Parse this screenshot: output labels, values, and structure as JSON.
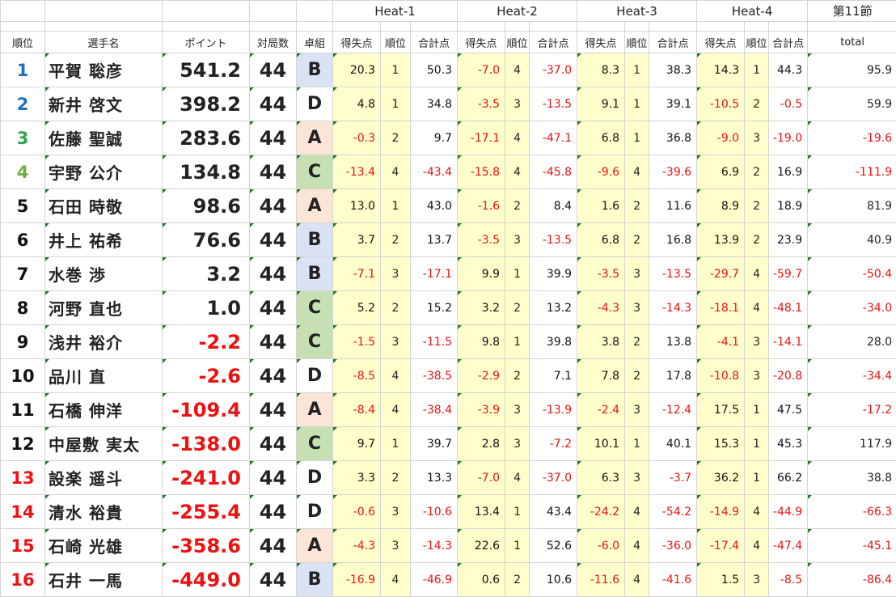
{
  "colors": {
    "group_B": "#dae3f3",
    "group_A": "#fbe5d6",
    "group_C": "#c6e0b4",
    "group_D": "#ffffff",
    "rank_1": "#1f6fc5",
    "rank_2": "#1f6fc5",
    "rank_3": "#2ea84a",
    "rank_4": "#70ad47",
    "rank_default": "#111111",
    "rank_bottom": "#ee1111",
    "negative": "#ee1111",
    "score_bg": "#ffffcc"
  },
  "header": {
    "heats": [
      "Heat-1",
      "Heat-2",
      "Heat-3",
      "Heat-4"
    ],
    "section": "第11節",
    "rank": "順位",
    "player": "選手名",
    "points": "ポイント",
    "games": "対局数",
    "table": "卓組",
    "score": "得失点",
    "place": "順位",
    "subtotal": "合計点",
    "total": "total"
  },
  "rows": [
    {
      "rank": "1",
      "name": "平賀 聡彦",
      "points": "541.2",
      "games": "44",
      "group": "B",
      "heats": [
        [
          "20.3",
          "1",
          "50.3"
        ],
        [
          "-7.0",
          "4",
          "-37.0"
        ],
        [
          "8.3",
          "1",
          "38.3"
        ],
        [
          "14.3",
          "1",
          "44.3"
        ]
      ],
      "total": "95.9"
    },
    {
      "rank": "2",
      "name": "新井 啓文",
      "points": "398.2",
      "games": "44",
      "group": "D",
      "heats": [
        [
          "4.8",
          "1",
          "34.8"
        ],
        [
          "-3.5",
          "3",
          "-13.5"
        ],
        [
          "9.1",
          "1",
          "39.1"
        ],
        [
          "-10.5",
          "2",
          "-0.5"
        ]
      ],
      "total": "59.9"
    },
    {
      "rank": "3",
      "name": "佐藤 聖誠",
      "points": "283.6",
      "games": "44",
      "group": "A",
      "heats": [
        [
          "-0.3",
          "2",
          "9.7"
        ],
        [
          "-17.1",
          "4",
          "-47.1"
        ],
        [
          "6.8",
          "1",
          "36.8"
        ],
        [
          "-9.0",
          "3",
          "-19.0"
        ]
      ],
      "total": "-19.6"
    },
    {
      "rank": "4",
      "name": "宇野 公介",
      "points": "134.8",
      "games": "44",
      "group": "C",
      "heats": [
        [
          "-13.4",
          "4",
          "-43.4"
        ],
        [
          "-15.8",
          "4",
          "-45.8"
        ],
        [
          "-9.6",
          "4",
          "-39.6"
        ],
        [
          "6.9",
          "2",
          "16.9"
        ]
      ],
      "total": "-111.9"
    },
    {
      "rank": "5",
      "name": "石田 時敬",
      "points": "98.6",
      "games": "44",
      "group": "A",
      "heats": [
        [
          "13.0",
          "1",
          "43.0"
        ],
        [
          "-1.6",
          "2",
          "8.4"
        ],
        [
          "1.6",
          "2",
          "11.6"
        ],
        [
          "8.9",
          "2",
          "18.9"
        ]
      ],
      "total": "81.9"
    },
    {
      "rank": "6",
      "name": "井上 祐希",
      "points": "76.6",
      "games": "44",
      "group": "B",
      "heats": [
        [
          "3.7",
          "2",
          "13.7"
        ],
        [
          "-3.5",
          "3",
          "-13.5"
        ],
        [
          "6.8",
          "2",
          "16.8"
        ],
        [
          "13.9",
          "2",
          "23.9"
        ]
      ],
      "total": "40.9"
    },
    {
      "rank": "7",
      "name": "水巻 渉",
      "points": "3.2",
      "games": "44",
      "group": "B",
      "heats": [
        [
          "-7.1",
          "3",
          "-17.1"
        ],
        [
          "9.9",
          "1",
          "39.9"
        ],
        [
          "-3.5",
          "3",
          "-13.5"
        ],
        [
          "-29.7",
          "4",
          "-59.7"
        ]
      ],
      "total": "-50.4"
    },
    {
      "rank": "8",
      "name": "河野 直也",
      "points": "1.0",
      "games": "44",
      "group": "C",
      "heats": [
        [
          "5.2",
          "2",
          "15.2"
        ],
        [
          "3.2",
          "2",
          "13.2"
        ],
        [
          "-4.3",
          "3",
          "-14.3"
        ],
        [
          "-18.1",
          "4",
          "-48.1"
        ]
      ],
      "total": "-34.0"
    },
    {
      "rank": "9",
      "name": "浅井 裕介",
      "points": "-2.2",
      "games": "44",
      "group": "C",
      "heats": [
        [
          "-1.5",
          "3",
          "-11.5"
        ],
        [
          "9.8",
          "1",
          "39.8"
        ],
        [
          "3.8",
          "2",
          "13.8"
        ],
        [
          "-4.1",
          "3",
          "-14.1"
        ]
      ],
      "total": "28.0"
    },
    {
      "rank": "10",
      "name": "品川 直",
      "points": "-2.6",
      "games": "44",
      "group": "D",
      "heats": [
        [
          "-8.5",
          "4",
          "-38.5"
        ],
        [
          "-2.9",
          "2",
          "7.1"
        ],
        [
          "7.8",
          "2",
          "17.8"
        ],
        [
          "-10.8",
          "3",
          "-20.8"
        ]
      ],
      "total": "-34.4"
    },
    {
      "rank": "11",
      "name": "石橋 伸洋",
      "points": "-109.4",
      "games": "44",
      "group": "A",
      "heats": [
        [
          "-8.4",
          "4",
          "-38.4"
        ],
        [
          "-3.9",
          "3",
          "-13.9"
        ],
        [
          "-2.4",
          "3",
          "-12.4"
        ],
        [
          "17.5",
          "1",
          "47.5"
        ]
      ],
      "total": "-17.2"
    },
    {
      "rank": "12",
      "name": "中屋敷 実太",
      "points": "-138.0",
      "games": "44",
      "group": "C",
      "heats": [
        [
          "9.7",
          "1",
          "39.7"
        ],
        [
          "2.8",
          "3",
          "-7.2"
        ],
        [
          "10.1",
          "1",
          "40.1"
        ],
        [
          "15.3",
          "1",
          "45.3"
        ]
      ],
      "total": "117.9"
    },
    {
      "rank": "13",
      "name": "設楽 遥斗",
      "points": "-241.0",
      "games": "44",
      "group": "D",
      "heats": [
        [
          "3.3",
          "2",
          "13.3"
        ],
        [
          "-7.0",
          "4",
          "-37.0"
        ],
        [
          "6.3",
          "3",
          "-3.7"
        ],
        [
          "36.2",
          "1",
          "66.2"
        ]
      ],
      "total": "38.8"
    },
    {
      "rank": "14",
      "name": "清水 裕貴",
      "points": "-255.4",
      "games": "44",
      "group": "D",
      "heats": [
        [
          "-0.6",
          "3",
          "-10.6"
        ],
        [
          "13.4",
          "1",
          "43.4"
        ],
        [
          "-24.2",
          "4",
          "-54.2"
        ],
        [
          "-14.9",
          "4",
          "-44.9"
        ]
      ],
      "total": "-66.3"
    },
    {
      "rank": "15",
      "name": "石崎 光雄",
      "points": "-358.6",
      "games": "44",
      "group": "A",
      "heats": [
        [
          "-4.3",
          "3",
          "-14.3"
        ],
        [
          "22.6",
          "1",
          "52.6"
        ],
        [
          "-6.0",
          "4",
          "-36.0"
        ],
        [
          "-17.4",
          "4",
          "-47.4"
        ]
      ],
      "total": "-45.1"
    },
    {
      "rank": "16",
      "name": "石井 一馬",
      "points": "-449.0",
      "games": "44",
      "group": "B",
      "heats": [
        [
          "-16.9",
          "4",
          "-46.9"
        ],
        [
          "0.6",
          "2",
          "10.6"
        ],
        [
          "-11.6",
          "4",
          "-41.6"
        ],
        [
          "1.5",
          "3",
          "-8.5"
        ]
      ],
      "total": "-86.4"
    }
  ]
}
